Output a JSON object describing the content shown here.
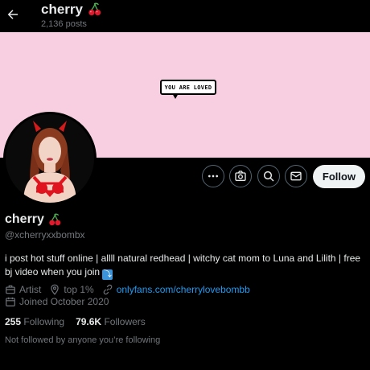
{
  "header": {
    "back_label": "Back",
    "title": "cherry",
    "post_count": "2,136 posts"
  },
  "banner": {
    "bubble_text": "YOU ARE LOVED",
    "background_color": "#f8cfe0"
  },
  "actions": {
    "more_icon": "more-horizontal-icon",
    "subscribe_icon": "camera-subscribe-icon",
    "search_icon": "search-icon",
    "message_icon": "envelope-icon",
    "follow_label": "Follow"
  },
  "profile": {
    "display_name": "cherry",
    "handle": "@xcherryxxbombx",
    "bio": "i post hot stuff online | allll natural redhead | witchy cat mom to Luna and Lilith | free bj video when you join",
    "bio_emoji": "⤵",
    "category": "Artist",
    "location": "top 1%",
    "website": "onlyfans.com/cherrylovebombb",
    "joined": "Joined October 2020"
  },
  "stats": {
    "following_count": "255",
    "following_label": "Following",
    "followers_count": "79.6K",
    "followers_label": "Followers"
  },
  "followed_by": "Not followed by anyone you’re following",
  "colors": {
    "background": "#000000",
    "link": "#1d9bf0",
    "muted": "#71767b",
    "follow_button_bg": "#eff3f4"
  }
}
